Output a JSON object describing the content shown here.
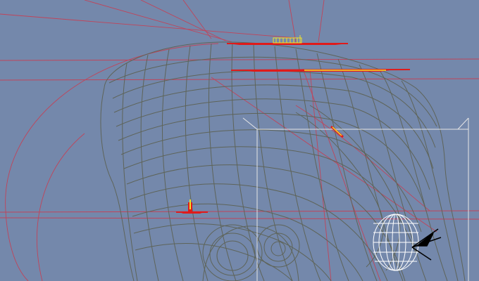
{
  "viewport": {
    "background_color": "#7488ab",
    "mesh_color": "#5e6459",
    "guide_color": "#c0445a",
    "selection_color": "#e01a1a",
    "highlight_color": "#f2e22a",
    "bbox_color": "#e6e6e6",
    "gizmo_color": "#ffffff"
  },
  "objects": [
    {
      "name": "head-mesh",
      "kind": "polygon-wireframe"
    },
    {
      "name": "eye-wireframe-object",
      "kind": "cylinder-wireframe"
    },
    {
      "name": "ear-mesh",
      "kind": "polygon-wireframe"
    }
  ],
  "handles": [
    {
      "name": "top-handle",
      "color": "red"
    },
    {
      "name": "brow-handle",
      "color": "red"
    },
    {
      "name": "side-handle",
      "color": "red"
    },
    {
      "name": "temple-marker",
      "color": "yellow"
    }
  ]
}
